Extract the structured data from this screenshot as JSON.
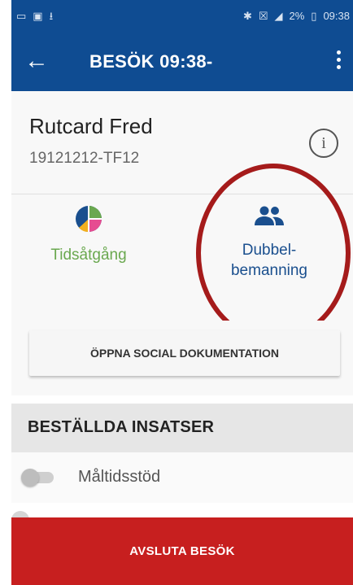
{
  "status_bar": {
    "battery": "2%",
    "time": "09:38"
  },
  "app_bar": {
    "title": "BESÖK 09:38-"
  },
  "patient": {
    "name": "Rutcard Fred",
    "id": "19121212-TF12"
  },
  "features": [
    {
      "label": "Tidsåtgång",
      "icon": "pie-chart-icon",
      "color": "#6aa84f"
    },
    {
      "label": "Dubbel-\nbemanning",
      "icon": "group-icon",
      "color": "#1a4f8e"
    }
  ],
  "doc_button": {
    "label": "ÖPPNA SOCIAL DOKUMENTATION"
  },
  "interventions": {
    "title": "BESTÄLLDA INSATSER",
    "items": [
      {
        "label": "Måltidsstöd",
        "enabled": false
      }
    ]
  },
  "end_button": {
    "label": "AVSLUTA BESÖK"
  },
  "colors": {
    "primary": "#0f4c92",
    "accent_red": "#c71f1f",
    "annotation": "#a51b1b"
  }
}
